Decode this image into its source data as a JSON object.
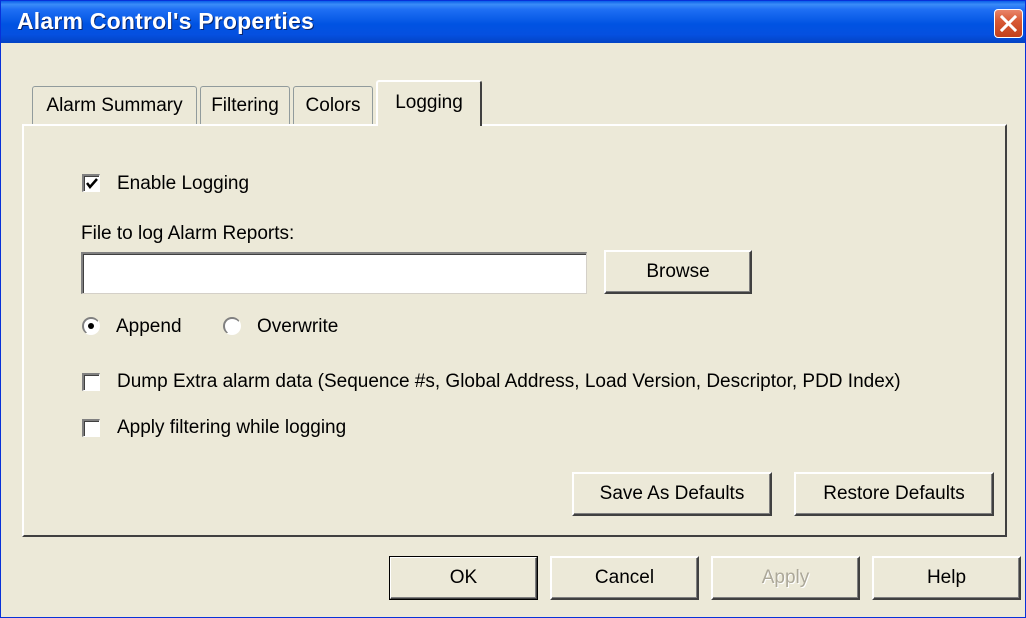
{
  "window": {
    "title": "Alarm Control's Properties"
  },
  "tabs": [
    {
      "label": "Alarm Summary",
      "active": false
    },
    {
      "label": "Filtering",
      "active": false
    },
    {
      "label": "Colors",
      "active": false
    },
    {
      "label": "Logging",
      "active": true
    }
  ],
  "logging": {
    "enable_logging": {
      "label": "Enable Logging",
      "checked": true
    },
    "file_label": "File to log Alarm Reports:",
    "file_value": "",
    "browse_label": "Browse",
    "mode": {
      "append_label": "Append",
      "overwrite_label": "Overwrite",
      "selected": "Append"
    },
    "dump_extra": {
      "label": "Dump Extra alarm data (Sequence #s, Global Address, Load Version, Descriptor, PDD Index)",
      "checked": false
    },
    "apply_filtering": {
      "label": "Apply filtering while logging",
      "checked": false
    },
    "save_defaults_label": "Save As Defaults",
    "restore_defaults_label": "Restore Defaults"
  },
  "footer": {
    "ok_label": "OK",
    "cancel_label": "Cancel",
    "apply_label": "Apply",
    "help_label": "Help"
  },
  "colors": {
    "titlebar": "#0053e2",
    "dialog_bg": "#ece9d8",
    "close_button": "#d85a36",
    "disabled_text": "#aca899"
  }
}
